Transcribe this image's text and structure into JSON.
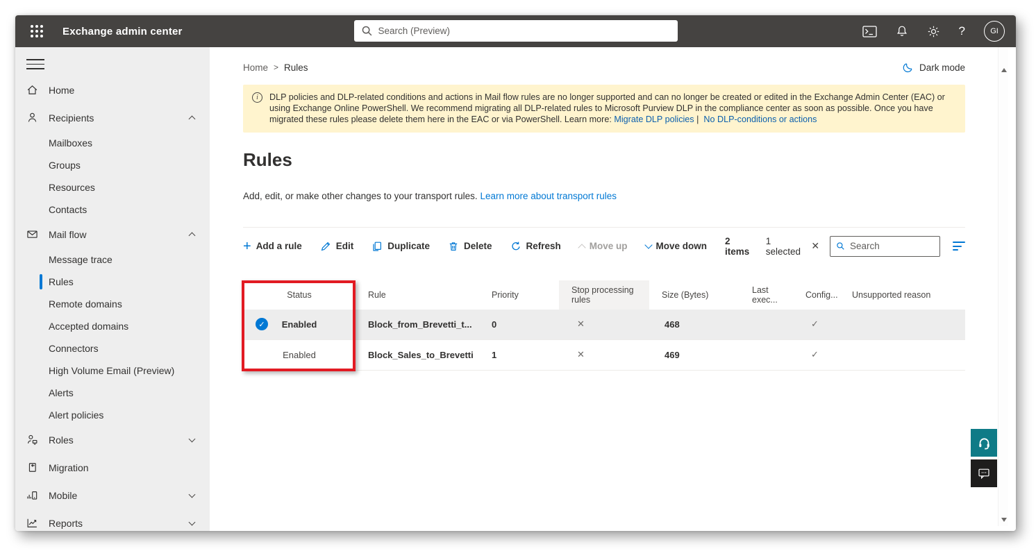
{
  "topbar": {
    "title": "Exchange admin center",
    "search_placeholder": "Search (Preview)",
    "avatar_initials": "GI"
  },
  "breadcrumb": {
    "home": "Home",
    "separator": ">",
    "current": "Rules"
  },
  "darkmode_label": "Dark mode",
  "banner": {
    "info_glyph": "i",
    "text": "DLP policies and DLP-related conditions and actions in Mail flow rules are no longer supported and can no longer be created or edited in the Exchange Admin Center (EAC) or using Exchange Online PowerShell. We recommend migrating all DLP-related rules to Microsoft Purview DLP in the compliance center as soon as possible. Once you have migrated these rules please delete them here in the EAC or via PowerShell. Learn more: ",
    "link1": "Migrate DLP policies",
    "separator": "|",
    "link2": "No DLP-conditions or actions"
  },
  "page": {
    "title": "Rules",
    "description": "Add, edit, or make other changes to your transport rules. ",
    "description_link": "Learn more about transport rules"
  },
  "toolbar": {
    "add_label": "Add a rule",
    "plus_glyph": "+",
    "edit_label": "Edit",
    "duplicate_label": "Duplicate",
    "delete_label": "Delete",
    "refresh_label": "Refresh",
    "move_up_label": "Move up",
    "move_down_label": "Move down",
    "items_count": "2 items",
    "selected_count": "1 selected",
    "clear_selection_glyph": "✕",
    "search_placeholder": "Search"
  },
  "icons": {
    "check": "✓",
    "cross": "✕",
    "question": "?"
  },
  "table": {
    "columns": [
      "Status",
      "Rule",
      "Priority",
      "Stop processing rules",
      "Size (Bytes)",
      "Last exec...",
      "Config...",
      "Unsupported reason"
    ],
    "rows": [
      {
        "selected": true,
        "status": "Enabled",
        "rule": "Block_from_Brevetti_t...",
        "priority": "0",
        "stop_processing_rules": "no",
        "size_bytes": "468",
        "configured": "yes",
        "last_exec": "",
        "unsupported_reason": ""
      },
      {
        "selected": false,
        "status": "Enabled",
        "rule": "Block_Sales_to_Brevetti",
        "priority": "1",
        "stop_processing_rules": "no",
        "size_bytes": "469",
        "configured": "yes",
        "last_exec": "",
        "unsupported_reason": ""
      }
    ]
  },
  "sidebar": {
    "items": [
      {
        "label": "Home"
      },
      {
        "label": "Recipients",
        "expanded": true
      },
      {
        "label": "Mailboxes"
      },
      {
        "label": "Groups"
      },
      {
        "label": "Resources"
      },
      {
        "label": "Contacts"
      },
      {
        "label": "Mail flow",
        "expanded": true
      },
      {
        "label": "Message trace"
      },
      {
        "label": "Rules",
        "selected": true
      },
      {
        "label": "Remote domains"
      },
      {
        "label": "Accepted domains"
      },
      {
        "label": "Connectors"
      },
      {
        "label": "High Volume Email (Preview)"
      },
      {
        "label": "Alerts"
      },
      {
        "label": "Alert policies"
      },
      {
        "label": "Roles",
        "collapsed": true
      },
      {
        "label": "Migration"
      },
      {
        "label": "Mobile",
        "collapsed": true
      },
      {
        "label": "Reports",
        "collapsed": true
      }
    ]
  },
  "colors": {
    "accent": "#0078d4",
    "topbar_bg": "#454341",
    "sidebar_bg": "#eeeeee",
    "banner_bg": "#fff4ce",
    "selected_row_bg": "#ededed",
    "annotation_red": "#e21b23",
    "help_teal": "#0f7b87",
    "feedback_black": "#1e1d1c"
  }
}
